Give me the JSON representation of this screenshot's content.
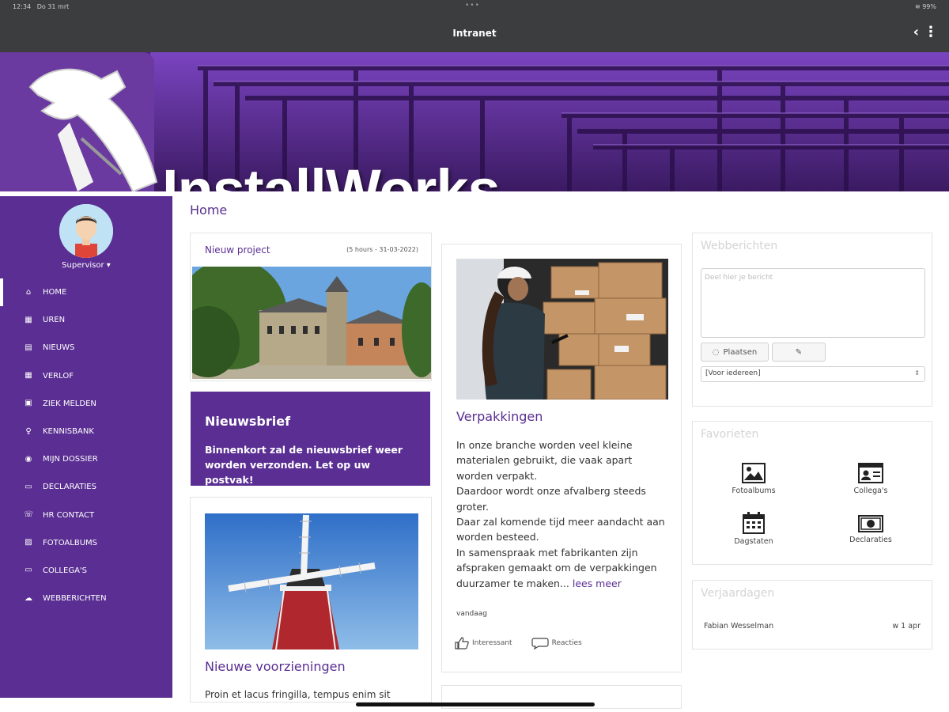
{
  "status": {
    "time": "12:34",
    "date": "Do 31 mrt",
    "dots": "•••",
    "right": "≋ 99%"
  },
  "app": {
    "title": "Intranet",
    "back_icon": "chevron-left-icon",
    "menu_icon": "more-vertical-icon"
  },
  "banner": {
    "brand": "InstallWorks"
  },
  "sidebar": {
    "role": "Supervisor ▾",
    "items": [
      {
        "label": "HOME",
        "icon": "home-icon"
      },
      {
        "label": "UREN",
        "icon": "calendar-icon"
      },
      {
        "label": "NIEUWS",
        "icon": "news-icon"
      },
      {
        "label": "VERLOF",
        "icon": "calendar-icon"
      },
      {
        "label": "ZIEK MELDEN",
        "icon": "briefcase-icon"
      },
      {
        "label": "KENNISBANK",
        "icon": "lightbulb-icon"
      },
      {
        "label": "MIJN DOSSIER",
        "icon": "user-circle-icon"
      },
      {
        "label": "DECLARATIES",
        "icon": "money-icon"
      },
      {
        "label": "HR CONTACT",
        "icon": "contact-icon"
      },
      {
        "label": "FOTOALBUMS",
        "icon": "image-icon"
      },
      {
        "label": "COLLEGA'S",
        "icon": "id-card-icon"
      },
      {
        "label": "WEBBERICHTEN",
        "icon": "chat-icon"
      }
    ]
  },
  "breadcrumb": "Home",
  "project_card": {
    "title": "Nieuw project",
    "meta": "(5 hours - 31-03-2022)"
  },
  "newsletter": {
    "title": "Nieuwsbrief",
    "text": "Binnenkort zal de nieuwsbrief weer worden verzonden. Let op uw postvak!"
  },
  "facilities_card": {
    "title": "Nieuwe voorzieningen",
    "text": "Proin et lacus fringilla, tempus enim sit"
  },
  "packaging_card": {
    "title": "Verpakkingen",
    "para1": "In onze branche worden veel kleine materialen gebruikt, die vaak apart worden verpakt.",
    "para2": "Daardoor wordt onze afvalberg steeds groter.",
    "para3": "Daar zal komende tijd meer aandacht aan worden besteed.",
    "para4": "In samenspraak met fabrikanten zijn afspraken gemaakt om de verpakkingen duurzamer te maken...",
    "more": "lees meer",
    "date": "vandaag",
    "like_label": "Interessant",
    "comment_label": "Reacties"
  },
  "webberichten": {
    "title": "Webberichten",
    "placeholder": "Deel hier je bericht",
    "post_label": "Plaatsen",
    "edit_icon": "✎",
    "audience": "[Voor iedereen]"
  },
  "favorites": {
    "title": "Favorieten",
    "items": [
      {
        "label": "Fotoalbums",
        "icon": "image-icon"
      },
      {
        "label": "Collega's",
        "icon": "id-card-icon"
      },
      {
        "label": "Dagstaten",
        "icon": "calendar-grid-icon"
      },
      {
        "label": "Declaraties",
        "icon": "money-icon"
      }
    ]
  },
  "birthdays": {
    "title": "Verjaardagen",
    "name": "Fabian Wesselman",
    "when": "w 1 apr"
  }
}
